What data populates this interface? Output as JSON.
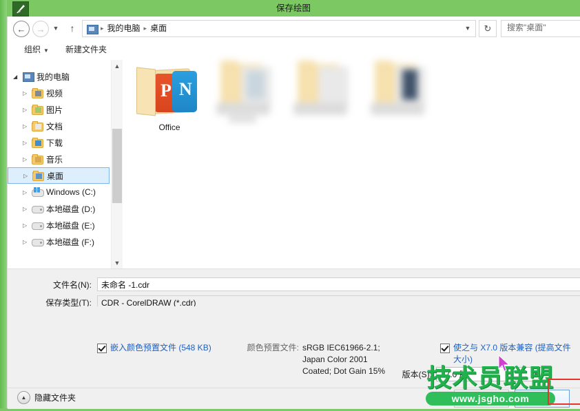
{
  "window": {
    "title": "保存绘图",
    "app_icon": "pen-nib-icon",
    "titlebar_color": "#7cc862"
  },
  "nav": {
    "back": "back-arrow",
    "forward": "forward-arrow",
    "recent": "recent-dropdown",
    "up": "up-arrow",
    "refresh": "refresh-icon",
    "breadcrumb": [
      "我的电脑",
      "桌面"
    ],
    "breadcrumb_sep": "▸",
    "address_dropdown": "chevron-down-icon",
    "search_placeholder": "搜索\"桌面\""
  },
  "command_bar": {
    "organize": "组织",
    "organize_caret": "▼",
    "new_folder": "新建文件夹"
  },
  "tree": {
    "items": [
      {
        "label": "我的电脑",
        "icon": "computer-icon",
        "indent": 0,
        "expander": "◢",
        "selected": false
      },
      {
        "label": "视频",
        "icon": "folder-videos-icon",
        "indent": 1,
        "expander": "▷",
        "selected": false
      },
      {
        "label": "图片",
        "icon": "folder-pictures-icon",
        "indent": 1,
        "expander": "▷",
        "selected": false
      },
      {
        "label": "文档",
        "icon": "folder-documents-icon",
        "indent": 1,
        "expander": "▷",
        "selected": false
      },
      {
        "label": "下载",
        "icon": "folder-downloads-icon",
        "indent": 1,
        "expander": "▷",
        "selected": false
      },
      {
        "label": "音乐",
        "icon": "folder-music-icon",
        "indent": 1,
        "expander": "▷",
        "selected": false
      },
      {
        "label": "桌面",
        "icon": "folder-desktop-icon",
        "indent": 1,
        "expander": "▷",
        "selected": true
      },
      {
        "label": "Windows (C:)",
        "icon": "drive-windows-icon",
        "indent": 1,
        "expander": "▷",
        "selected": false
      },
      {
        "label": "本地磁盘 (D:)",
        "icon": "drive-icon",
        "indent": 1,
        "expander": "▷",
        "selected": false
      },
      {
        "label": "本地磁盘 (E:)",
        "icon": "drive-icon",
        "indent": 1,
        "expander": "▷",
        "selected": false
      },
      {
        "label": "本地磁盘 (F:)",
        "icon": "drive-icon",
        "indent": 1,
        "expander": "▷",
        "selected": false
      }
    ],
    "scroll_up": "▲",
    "scroll_down": "▼"
  },
  "files": [
    {
      "label": "Office",
      "icon": "office-folder-icon",
      "blurred": false
    },
    {
      "label": "",
      "icon": "folder-icon",
      "blurred": true
    },
    {
      "label": "",
      "icon": "folder-icon",
      "blurred": true
    },
    {
      "label": "",
      "icon": "folder-icon",
      "blurred": true
    }
  ],
  "form": {
    "filename_label": "文件名(N):",
    "filename_value": "未命名 -1.cdr",
    "filetype_label": "保存类型(T):",
    "filetype_value": "CDR - CorelDRAW (*.cdr)"
  },
  "options": {
    "embed_checkbox_label": "嵌入颜色预置文件 (548 KB)",
    "embed_checked": true,
    "profile_label": "颜色预置文件:",
    "profile_lines": [
      "sRGB IEC61966-2.1;",
      "Japan Color 2001",
      "Coated; Dot Gain 15%"
    ],
    "compat_checkbox_label": "使之与 X7.0 版本兼容 (提高文件大小)",
    "compat_checked": true,
    "version_label": "版本(S):",
    "version_value": "17.0 版",
    "version_caret": "▼",
    "link_color": "#1f5fbf"
  },
  "bottom": {
    "hide_folders": "隐藏文件夹",
    "hide_folders_icon": "▲",
    "advanced_button": "高级(A)",
    "save_button": "保存"
  },
  "watermark": {
    "title": "技术员联盟",
    "url": "www.jsgho.com",
    "color": "#22b14c"
  },
  "annotation": {
    "highlight_color": "#e8332a",
    "cursor": "mouse-pointer"
  }
}
